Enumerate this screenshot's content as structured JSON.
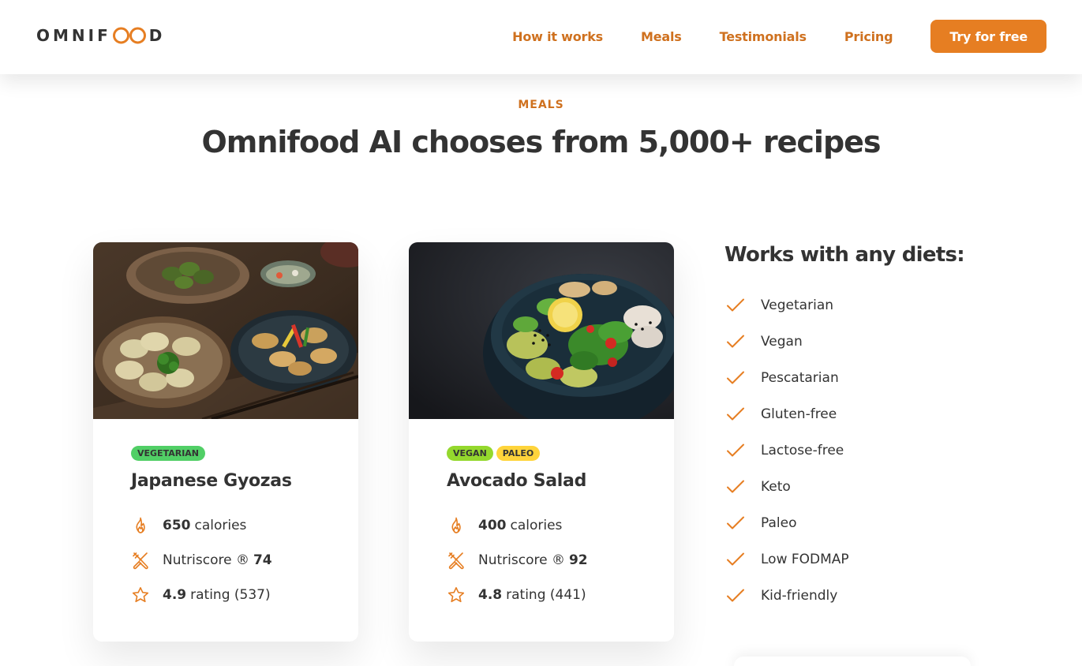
{
  "header": {
    "logo_text_start": "OMNIF",
    "logo_text_end": "D",
    "logo_icon": "infinity-oo-icon",
    "nav": [
      "How it works",
      "Meals",
      "Testimonials",
      "Pricing"
    ],
    "cta": "Try for free"
  },
  "section": {
    "subheading": "MEALS",
    "heading": "Omnifood AI chooses from 5,000+ recipes"
  },
  "meals": [
    {
      "image": "gyoza-photo",
      "tags": [
        "VEGETARIAN"
      ],
      "title": "Japanese Gyozas",
      "calories_value": "650",
      "calories_label": "calories",
      "nutriscore_label": "Nutriscore ®",
      "nutriscore_value": "74",
      "rating_value": "4.9",
      "rating_label": "rating (537)"
    },
    {
      "image": "avocado-salad-photo",
      "tags": [
        "VEGAN",
        "PALEO"
      ],
      "title": "Avocado Salad",
      "calories_value": "400",
      "calories_label": "calories",
      "nutriscore_label": "Nutriscore ®",
      "nutriscore_value": "92",
      "rating_value": "4.8",
      "rating_label": "rating (441)"
    }
  ],
  "diets": {
    "title": "Works with any diets:",
    "items": [
      "Vegetarian",
      "Vegan",
      "Pescatarian",
      "Gluten-free",
      "Lactose-free",
      "Keto",
      "Paleo",
      "Low FODMAP",
      "Kid-friendly"
    ]
  },
  "icons": {
    "flame": "flame-icon",
    "nutri": "utensils-icon",
    "star": "star-icon",
    "check": "checkmark-icon"
  },
  "colors": {
    "primary": "#e67e22",
    "primary_dark": "#cf711f",
    "text": "#333333",
    "tag_vegetarian": "#51cf66",
    "tag_vegan": "#94d82d",
    "tag_paleo": "#ffd43b"
  }
}
